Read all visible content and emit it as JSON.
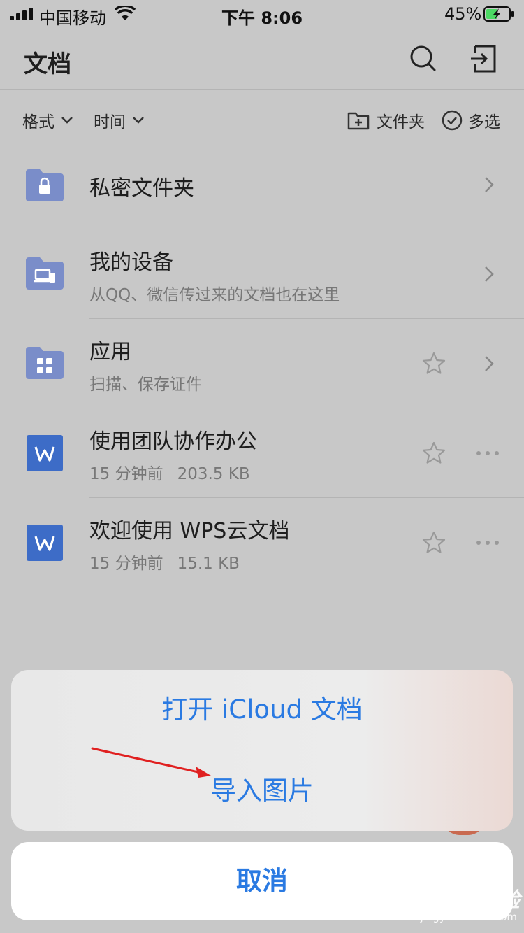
{
  "status": {
    "carrier": "中国移动",
    "time": "下午 8:06",
    "battery": "45%"
  },
  "header": {
    "title": "文档"
  },
  "toolbar": {
    "format": "格式",
    "time": "时间",
    "folder": "文件夹",
    "multi": "多选"
  },
  "list": [
    {
      "name": "私密文件夹"
    },
    {
      "name": "我的设备",
      "subtitle": "从QQ、微信传过来的文档也在这里"
    },
    {
      "name": "应用",
      "subtitle": "扫描、保存证件"
    },
    {
      "name": "使用团队协作办公",
      "time": "15 分钟前",
      "size": "203.5 KB"
    },
    {
      "name": "欢迎使用 WPS云文档",
      "time": "15 分钟前",
      "size": "15.1 KB"
    }
  ],
  "sheet": {
    "open_icloud": "打开 iCloud 文档",
    "import_image": "导入图片",
    "cancel": "取消"
  },
  "watermark": {
    "main": "Baidu经验",
    "sub": "jingyan.baidu.com"
  },
  "colors": {
    "accent": "#2a7ae2",
    "folder": "#7a8dc9",
    "word": "#3d6cc7"
  }
}
